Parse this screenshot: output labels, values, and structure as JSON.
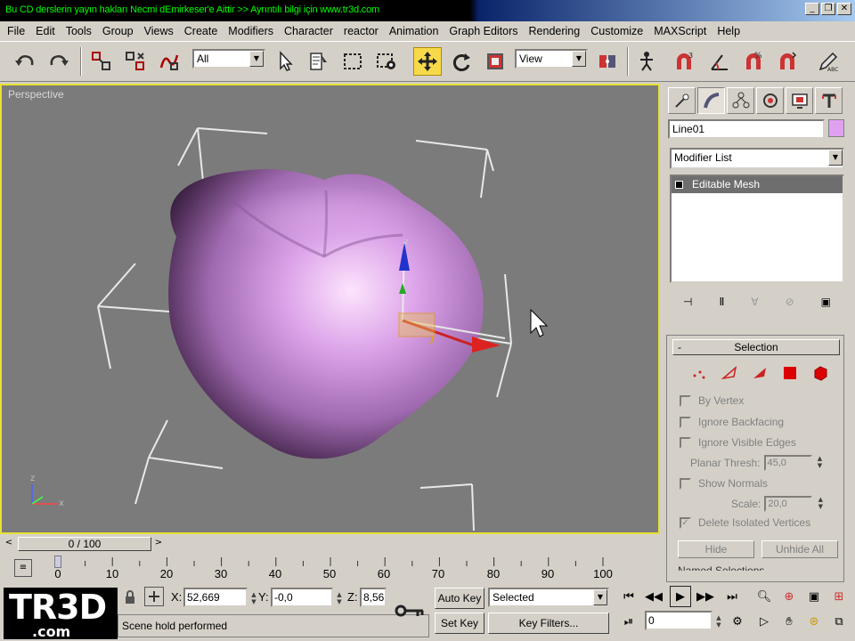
{
  "title_bar": {
    "text": "Bu CD derslerin yayın hakları Necmi dEmirkeser'e Aittir >> Ayrıntılı bilgi için  www.tr3d.com",
    "minimize": "_",
    "restore": "❐",
    "close": "✕"
  },
  "menu": [
    "File",
    "Edit",
    "Tools",
    "Group",
    "Views",
    "Create",
    "Modifiers",
    "Character",
    "reactor",
    "Animation",
    "Graph Editors",
    "Rendering",
    "Customize",
    "MAXScript",
    "Help"
  ],
  "toolbar": {
    "selection_filter": "All",
    "reference_coord": "View"
  },
  "viewport": {
    "label": "Perspective",
    "axis_labels": {
      "z": "z",
      "x": "x"
    }
  },
  "command_panel": {
    "object_name": "Line01",
    "object_color": "#e0a0f0",
    "modifier_list": "Modifier List",
    "stack_items": [
      "Editable Mesh"
    ],
    "selection_rollout": {
      "title": "Selection",
      "minus": "-",
      "by_vertex": "By Vertex",
      "ignore_backfacing": "Ignore Backfacing",
      "ignore_visible_edges": "Ignore Visible Edges",
      "planar_thresh_label": "Planar Thresh:",
      "planar_thresh_value": "45,0",
      "show_normals": "Show Normals",
      "scale_label": "Scale:",
      "scale_value": "20,0",
      "delete_isolated": "Delete Isolated Vertices",
      "delete_isolated_checked": true,
      "hide": "Hide",
      "unhide_all": "Unhide All",
      "named_selections": "Named Selections"
    }
  },
  "timeline": {
    "frame_display": "0 / 100",
    "ticks": [
      "0",
      "10",
      "20",
      "30",
      "40",
      "50",
      "60",
      "70",
      "80",
      "90",
      "100"
    ]
  },
  "bottom": {
    "logo_main": "TR3D",
    "logo_sub": ".com",
    "x_label": "X:",
    "x_value": "52,669",
    "y_label": "Y:",
    "y_value": "-0,0",
    "z_label": "Z:",
    "z_value": "8,56",
    "status": "Scene hold performed",
    "auto_key": "Auto Key",
    "set_key": "Set Key",
    "key_mode": "Selected",
    "key_filters": "Key Filters...",
    "current_frame": "0"
  }
}
